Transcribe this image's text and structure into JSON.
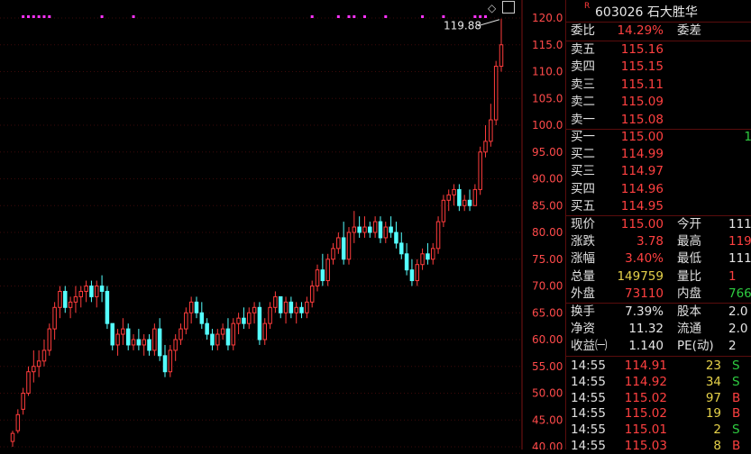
{
  "chart": {
    "y_ticks": [
      "120.0",
      "115.0",
      "110.0",
      "105.0",
      "100.0",
      "95.00",
      "90.00",
      "85.00",
      "80.00",
      "75.00",
      "70.00",
      "65.00",
      "60.00",
      "55.00",
      "50.00",
      "45.00",
      "40.00"
    ],
    "high_annotation": "119.88",
    "colors": {
      "up": "#ff3c3c",
      "down": "#54ffff",
      "marker": "#ff33ff",
      "grid": "#3d0a0a",
      "axis": "#7a1414"
    }
  },
  "chart_data": {
    "type": "candlestick",
    "ylim": [
      40,
      120
    ],
    "candles": [
      [
        41,
        43,
        40,
        42.5
      ],
      [
        43,
        47,
        42.5,
        46
      ],
      [
        47,
        51,
        46,
        50
      ],
      [
        50,
        55,
        49.5,
        54
      ],
      [
        54,
        58,
        52,
        55
      ],
      [
        55,
        58,
        53,
        56
      ],
      [
        56,
        60,
        55,
        58
      ],
      [
        58,
        63,
        57,
        62
      ],
      [
        62,
        67,
        60,
        66
      ],
      [
        66,
        70,
        64,
        69
      ],
      [
        69,
        70,
        65,
        66
      ],
      [
        66,
        68,
        64,
        67
      ],
      [
        67,
        70,
        65,
        68
      ],
      [
        68,
        70,
        66,
        69
      ],
      [
        69,
        71,
        67,
        70
      ],
      [
        70,
        71,
        67,
        68
      ],
      [
        68,
        71,
        66,
        70
      ],
      [
        70,
        72,
        67,
        69
      ],
      [
        69,
        70,
        62,
        63
      ],
      [
        63,
        63,
        58,
        59
      ],
      [
        59,
        62,
        57,
        61
      ],
      [
        61,
        64,
        59,
        62
      ],
      [
        62,
        63,
        58,
        59
      ],
      [
        59,
        61,
        58,
        60
      ],
      [
        60,
        62,
        58,
        59
      ],
      [
        59,
        61,
        57,
        60
      ],
      [
        60,
        61,
        57,
        58
      ],
      [
        58,
        63,
        57,
        62
      ],
      [
        62,
        64,
        56,
        57
      ],
      [
        57,
        59,
        53,
        54
      ],
      [
        54,
        59,
        53,
        58
      ],
      [
        58,
        61,
        56,
        60
      ],
      [
        60,
        63,
        59,
        62
      ],
      [
        62,
        66,
        61,
        65
      ],
      [
        65,
        68,
        63,
        67
      ],
      [
        67,
        68,
        64,
        65
      ],
      [
        65,
        67,
        62,
        63
      ],
      [
        63,
        64,
        60,
        61
      ],
      [
        61,
        62,
        58,
        59
      ],
      [
        59,
        62,
        58,
        61
      ],
      [
        61,
        63,
        60,
        62
      ],
      [
        62,
        64,
        58,
        59
      ],
      [
        59,
        64,
        58,
        63
      ],
      [
        63,
        65,
        61,
        64
      ],
      [
        64,
        66,
        62,
        63
      ],
      [
        63,
        66,
        62,
        65
      ],
      [
        65,
        67,
        63,
        66
      ],
      [
        66,
        67,
        59,
        60
      ],
      [
        60,
        64,
        59,
        63
      ],
      [
        63,
        67,
        62,
        66
      ],
      [
        66,
        69,
        65,
        68
      ],
      [
        68,
        68,
        64,
        65
      ],
      [
        65,
        68,
        63,
        67
      ],
      [
        67,
        68,
        64,
        65
      ],
      [
        65,
        67,
        63,
        66
      ],
      [
        66,
        67,
        64,
        65
      ],
      [
        65,
        68,
        64,
        67
      ],
      [
        67,
        71,
        66,
        70
      ],
      [
        70,
        74,
        69,
        73
      ],
      [
        73,
        76,
        70,
        71
      ],
      [
        71,
        76,
        70,
        75
      ],
      [
        75,
        78,
        74,
        77
      ],
      [
        77,
        80,
        76,
        79
      ],
      [
        79,
        82,
        74,
        75
      ],
      [
        75,
        81,
        74,
        80
      ],
      [
        80,
        84,
        78,
        81
      ],
      [
        81,
        83,
        79,
        80
      ],
      [
        80,
        83,
        79,
        81
      ],
      [
        81,
        82,
        79,
        80
      ],
      [
        80,
        83,
        79,
        82
      ],
      [
        82,
        83,
        78,
        79
      ],
      [
        79,
        82,
        78,
        81
      ],
      [
        81,
        83,
        79,
        80
      ],
      [
        80,
        82,
        77,
        78
      ],
      [
        78,
        80,
        75,
        76
      ],
      [
        76,
        78,
        72,
        73
      ],
      [
        73,
        75,
        70,
        71
      ],
      [
        71,
        75,
        70,
        74
      ],
      [
        74,
        77,
        73,
        76
      ],
      [
        76,
        78,
        74,
        75
      ],
      [
        75,
        78,
        74,
        77
      ],
      [
        77,
        83,
        76,
        82
      ],
      [
        82,
        87,
        81,
        86
      ],
      [
        86,
        88,
        84,
        87
      ],
      [
        87,
        89,
        85,
        88
      ],
      [
        88,
        89,
        84,
        85
      ],
      [
        85,
        87,
        84,
        86
      ],
      [
        86,
        88,
        84,
        85
      ],
      [
        85,
        89,
        85,
        88
      ],
      [
        88,
        96,
        87,
        95
      ],
      [
        95,
        100,
        94,
        97
      ],
      [
        97,
        104,
        96,
        101
      ],
      [
        101,
        112,
        100,
        111
      ],
      [
        111,
        119.88,
        110,
        115
      ]
    ],
    "markers_top": [
      2,
      3,
      4,
      5,
      6,
      7,
      17,
      23,
      57,
      62,
      64,
      65,
      67,
      71,
      78,
      82,
      88,
      89,
      90
    ]
  },
  "sidebar": {
    "r_badge": "R",
    "title": "603026 石大胜华",
    "weibi_label": "委比",
    "weibi_value": "14.29%",
    "weicha_label": "委差",
    "sells": [
      {
        "label": "卖五",
        "price": "115.16"
      },
      {
        "label": "卖四",
        "price": "115.15"
      },
      {
        "label": "卖三",
        "price": "115.11"
      },
      {
        "label": "卖二",
        "price": "115.09"
      },
      {
        "label": "卖一",
        "price": "115.08"
      }
    ],
    "buys": [
      {
        "label": "买一",
        "price": "115.00",
        "vol": "1"
      },
      {
        "label": "买二",
        "price": "114.99",
        "vol": ""
      },
      {
        "label": "买三",
        "price": "114.97",
        "vol": ""
      },
      {
        "label": "买四",
        "price": "114.96",
        "vol": ""
      },
      {
        "label": "买五",
        "price": "114.95",
        "vol": ""
      }
    ],
    "stats": [
      {
        "l1": "现价",
        "v1": "115.00",
        "c1": "red",
        "l2": "今开",
        "v2": "111",
        "c2": "wht"
      },
      {
        "l1": "涨跌",
        "v1": "3.78",
        "c1": "red",
        "l2": "最高",
        "v2": "119",
        "c2": "red"
      },
      {
        "l1": "涨幅",
        "v1": "3.40%",
        "c1": "red",
        "l2": "最低",
        "v2": "111",
        "c2": "wht"
      },
      {
        "l1": "总量",
        "v1": "149759",
        "c1": "yel",
        "l2": "量比",
        "v2": "1",
        "c2": "red"
      },
      {
        "l1": "外盘",
        "v1": "73110",
        "c1": "red",
        "l2": "内盘",
        "v2": "766",
        "c2": "grn"
      }
    ],
    "stats2": [
      {
        "l1": "换手",
        "v1": "7.39%",
        "c1": "wht",
        "l2": "股本",
        "v2": "2.0"
      },
      {
        "l1": "净资",
        "v1": "11.32",
        "c1": "wht",
        "l2": "流通",
        "v2": "2.0"
      },
      {
        "l1": "收益㈠",
        "v1": "1.140",
        "c1": "wht",
        "l2": "PE(动)",
        "v2": "2"
      }
    ],
    "ticks": [
      {
        "time": "14:55",
        "price": "114.91",
        "vol": "23",
        "side": "S"
      },
      {
        "time": "14:55",
        "price": "114.92",
        "vol": "34",
        "side": "S"
      },
      {
        "time": "14:55",
        "price": "115.02",
        "vol": "97",
        "side": "B"
      },
      {
        "time": "14:55",
        "price": "115.02",
        "vol": "19",
        "side": "B"
      },
      {
        "time": "14:55",
        "price": "115.01",
        "vol": "2",
        "side": "S"
      },
      {
        "time": "14:55",
        "price": "115.03",
        "vol": "8",
        "side": "B"
      }
    ]
  }
}
